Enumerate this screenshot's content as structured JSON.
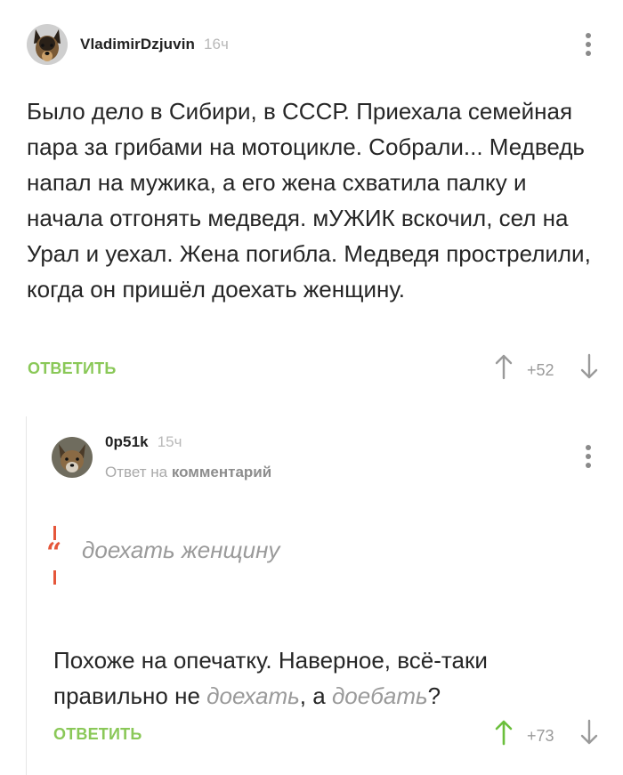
{
  "comments": [
    {
      "username": "VladimirDzjuvin",
      "time": "16ч",
      "avatar": "german-shepherd-avatar",
      "text": "Было дело в Сибири, в СССР. Приехала семейная пара за грибами на мотоцикле. Собрали... Медведь напал на мужика, а его жена схватила палку и начала отгонять медведя. мУЖИК вскочил, сел на Урал и уехал. Жена погибла. Медведя прострелили, когда он пришёл доехать женщину.",
      "reply_label": "ОТВЕТИТЬ",
      "score": "+52",
      "up_color": "#9a9a9a",
      "menu_icon": "more-vertical-icon"
    },
    {
      "username": "0p51k",
      "time": "15ч",
      "avatar": "fox-avatar",
      "reply_to_prefix": "Ответ на",
      "reply_to_target": "комментарий",
      "quote": "доехать женщину",
      "text_part1": "Похоже на опечатку. Наверное, всё-таки правильно не ",
      "text_word1": "доехать",
      "text_part2": ", а ",
      "text_word2": "доебать",
      "text_part3": "?",
      "reply_label": "ОТВЕТИТЬ",
      "score": "+73",
      "up_color": "#6bbf3c",
      "menu_icon": "more-vertical-icon"
    }
  ],
  "colors": {
    "accent_green": "#8ac858",
    "quote_red": "#e5563a",
    "muted": "#9a9a9a"
  }
}
